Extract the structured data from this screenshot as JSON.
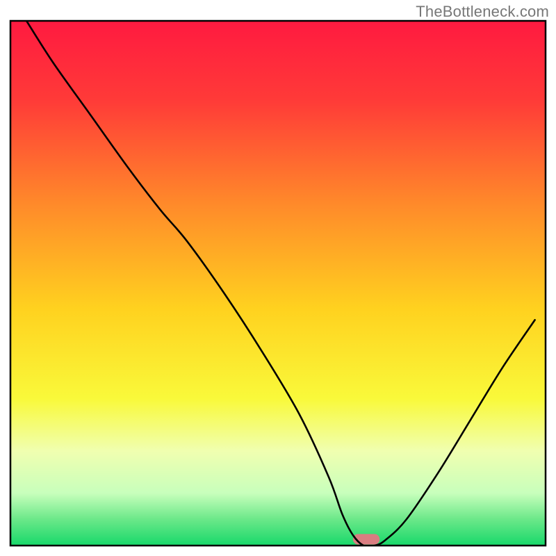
{
  "watermark": "TheBottleneck.com",
  "chart_data": {
    "type": "line",
    "title": "",
    "xlabel": "",
    "ylabel": "",
    "xlim": [
      0,
      100
    ],
    "ylim": [
      0,
      100
    ],
    "grid": false,
    "legend": false,
    "axes_visible": false,
    "background": {
      "type": "vertical-gradient",
      "stops": [
        {
          "offset": 0.0,
          "color": "#ff1a40"
        },
        {
          "offset": 0.15,
          "color": "#ff3a38"
        },
        {
          "offset": 0.35,
          "color": "#ff8a2a"
        },
        {
          "offset": 0.55,
          "color": "#ffd21f"
        },
        {
          "offset": 0.72,
          "color": "#f9f93a"
        },
        {
          "offset": 0.82,
          "color": "#f0ffb0"
        },
        {
          "offset": 0.9,
          "color": "#c8ffbc"
        },
        {
          "offset": 0.95,
          "color": "#6be889"
        },
        {
          "offset": 1.0,
          "color": "#17d86a"
        }
      ]
    },
    "series": [
      {
        "name": "bottleneck-curve",
        "color": "#000000",
        "stroke_width": 2.6,
        "x": [
          3,
          8,
          15,
          22,
          28,
          33,
          40,
          47,
          54,
          59.5,
          62,
          64,
          66,
          68,
          70,
          74,
          80,
          86,
          92,
          98
        ],
        "y": [
          100,
          92,
          82,
          72,
          64,
          58,
          48,
          37,
          25,
          13,
          6,
          2,
          0,
          0,
          1,
          5,
          14,
          24,
          34,
          43
        ]
      }
    ],
    "marker": {
      "name": "optimal-point",
      "shape": "rounded-rect",
      "color": "#d97d81",
      "cx": 66.5,
      "cy": 1.2,
      "w": 5,
      "h": 2
    },
    "frame": {
      "color": "#000000",
      "stroke_width": 2.5
    }
  }
}
